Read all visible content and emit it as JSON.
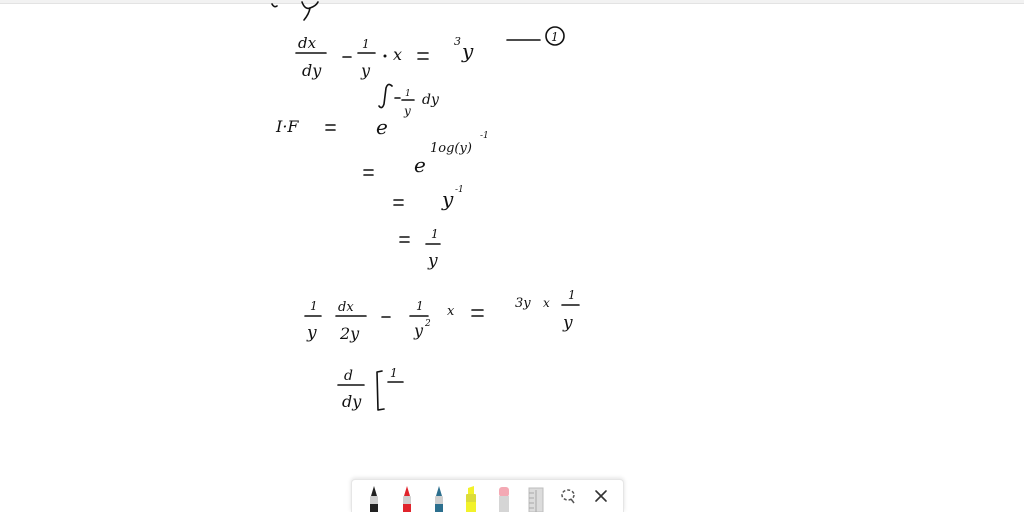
{
  "window": {
    "accent": "#111111"
  },
  "notes": {
    "line1": {
      "left": "dx/dy",
      "minus": "-",
      "coef": "1/y",
      "dot": "·",
      "x": "x",
      "eq": "=",
      "rhs": "3y",
      "tag": "1"
    },
    "if_label": "I·F",
    "eq": "=",
    "e": "e",
    "exp1": "∫-1/y dy",
    "exp2": "log(y)⁻¹",
    "step3": "y⁻¹",
    "step4": "1/y",
    "line6": {
      "coef": "1/y",
      "dxdy": "dx/dy",
      "minus": "-",
      "coef2": "1/y²",
      "x": "x",
      "eq": "=",
      "rhs": "3y x 1/y"
    },
    "line7": {
      "d": "d/dy",
      "bracket": "[",
      "partial": "1/"
    }
  },
  "toolbar": {
    "tools": [
      {
        "name": "black-pen-icon",
        "color": "#222222"
      },
      {
        "name": "red-pen-icon",
        "color": "#e0242c"
      },
      {
        "name": "blue-pen-icon",
        "color": "#2c6f8e"
      },
      {
        "name": "highlighter-icon",
        "color": "#f2f22a"
      },
      {
        "name": "eraser-icon",
        "color": "#f4a9b4"
      },
      {
        "name": "ruler-icon",
        "color": "#c8c8c8"
      },
      {
        "name": "lasso-icon",
        "color": "#555555"
      },
      {
        "name": "close-icon",
        "color": "#333333"
      }
    ]
  }
}
